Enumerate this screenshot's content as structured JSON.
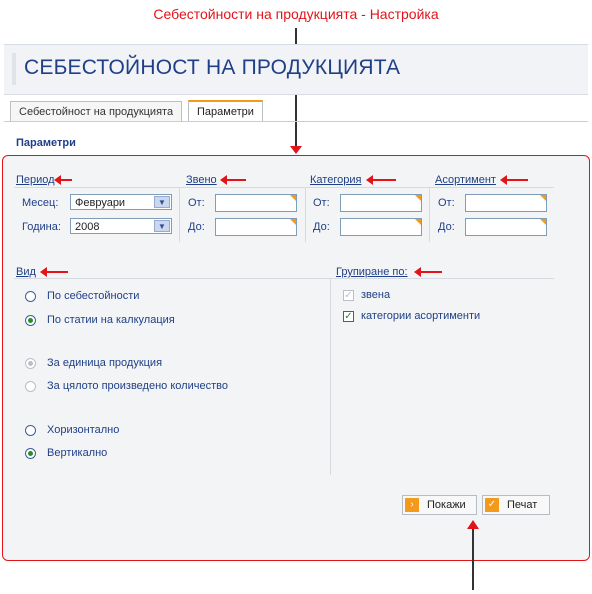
{
  "annotation": {
    "caption": "Себестойности на продукцията - Настройка"
  },
  "page": {
    "title": "СЕБЕСТОЙНОСТ НА ПРОДУКЦИЯТА"
  },
  "tabs": [
    {
      "label": "Себестойност на продукцията",
      "active": false
    },
    {
      "label": "Параметри",
      "active": true
    }
  ],
  "section_title": "Параметри",
  "period": {
    "label": "Период",
    "month_label": "Месец:",
    "month_value": "Февруари",
    "year_label": "Година:",
    "year_value": "2008"
  },
  "zveno": {
    "label": "Звено",
    "from_label": "От:",
    "to_label": "До:",
    "from_value": "",
    "to_value": ""
  },
  "category": {
    "label": "Категория",
    "from_label": "От:",
    "to_label": "До:",
    "from_value": "",
    "to_value": ""
  },
  "assortment": {
    "label": "Асортимент",
    "from_label": "От:",
    "to_label": "До:",
    "from_value": "",
    "to_value": ""
  },
  "vid": {
    "label": "Вид",
    "options": [
      {
        "label": "По себестойности",
        "selected": false,
        "disabled": false
      },
      {
        "label": "По статии на калкулация",
        "selected": true,
        "disabled": false
      },
      {
        "label": "За единица продукция",
        "selected": true,
        "disabled": true
      },
      {
        "label": "За цялото произведено количество",
        "selected": false,
        "disabled": true
      },
      {
        "label": "Хоризонтално",
        "selected": false,
        "disabled": false
      },
      {
        "label": "Вертикално",
        "selected": true,
        "disabled": false
      }
    ]
  },
  "grouping": {
    "label": "Групиране по:",
    "options": [
      {
        "label": "звена",
        "checked": true,
        "disabled": true
      },
      {
        "label": "категории асортименти",
        "checked": true,
        "disabled": false
      }
    ]
  },
  "buttons": {
    "show": "Покажи",
    "print": "Печат"
  },
  "colors": {
    "annotation_red": "#e2141a",
    "title_blue": "#1f3f87",
    "accent_orange": "#f39a1c"
  }
}
